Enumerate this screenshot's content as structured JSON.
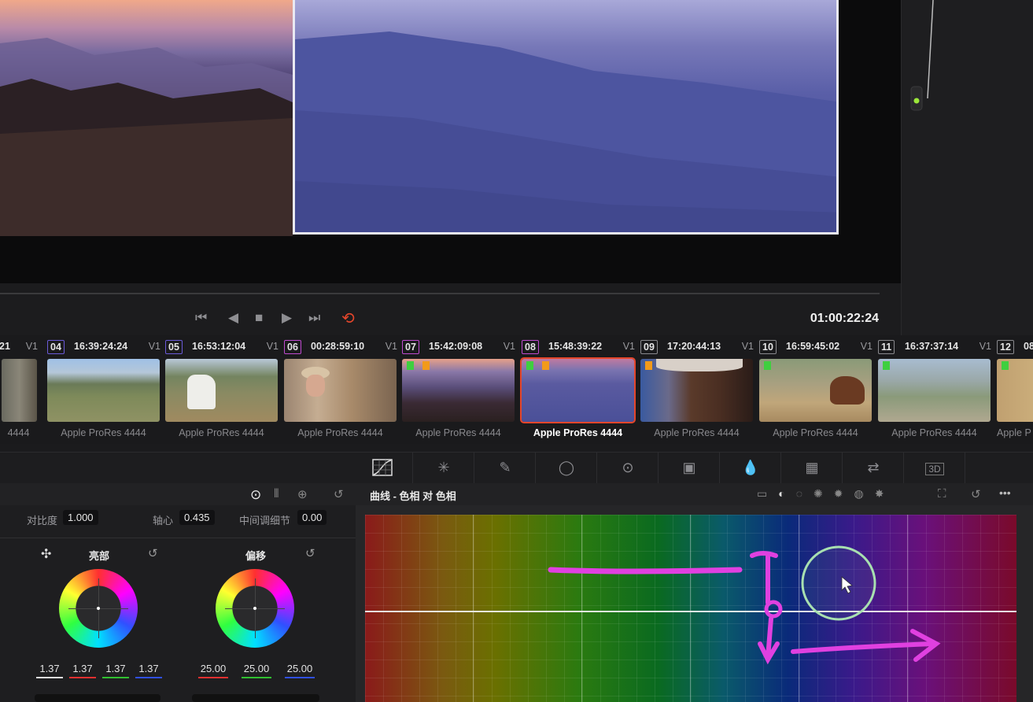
{
  "viewer": {
    "timecode": "01:00:22:24",
    "transport": {
      "first": "⏮",
      "prev": "◀",
      "stop": "■",
      "play": "▶",
      "last": "⏭",
      "loop": "⟲"
    }
  },
  "clips": [
    {
      "num": "21",
      "tc": "",
      "track": "V1",
      "codec": "4444"
    },
    {
      "num": "04",
      "tc": "16:39:24:24",
      "track": "V1",
      "codec": "Apple ProRes 4444"
    },
    {
      "num": "05",
      "tc": "16:53:12:04",
      "track": "V1",
      "codec": "Apple ProRes 4444"
    },
    {
      "num": "06",
      "tc": "00:28:59:10",
      "track": "V1",
      "codec": "Apple ProRes 4444"
    },
    {
      "num": "07",
      "tc": "15:42:09:08",
      "track": "V1",
      "codec": "Apple ProRes 4444"
    },
    {
      "num": "08",
      "tc": "15:48:39:22",
      "track": "V1",
      "codec": "Apple ProRes 4444"
    },
    {
      "num": "09",
      "tc": "17:20:44:13",
      "track": "V1",
      "codec": "Apple ProRes 4444"
    },
    {
      "num": "10",
      "tc": "16:59:45:02",
      "track": "V1",
      "codec": "Apple ProRes 4444"
    },
    {
      "num": "11",
      "tc": "16:37:37:14",
      "track": "V1",
      "codec": "Apple ProRes 4444"
    },
    {
      "num": "12",
      "tc": "08",
      "track": "",
      "codec": "Apple P"
    }
  ],
  "selected_clip": "08",
  "tools": [
    "curves-icon",
    "warper-icon",
    "qualifier-icon",
    "window-icon",
    "tracker-icon",
    "magic-mask-icon",
    "blur-icon",
    "key-icon",
    "sizing-icon",
    "3d-icon"
  ],
  "primaries": {
    "contrast_label": "对比度",
    "contrast_value": "1.000",
    "pivot_label": "轴心",
    "pivot_value": "0.435",
    "mid_detail_label": "中间调细节",
    "mid_detail_value": "0.00",
    "gain_label": "亮部",
    "offset_label": "偏移",
    "gain_values": [
      "1.37",
      "1.37",
      "1.37",
      "1.37"
    ],
    "offset_values": [
      "25.00",
      "25.00",
      "25.00"
    ]
  },
  "curves": {
    "title": "曲线 - 色相 对 色相",
    "more": "•••"
  },
  "colors": {
    "selection": "#e5462b",
    "annotation": "#e040e0"
  }
}
